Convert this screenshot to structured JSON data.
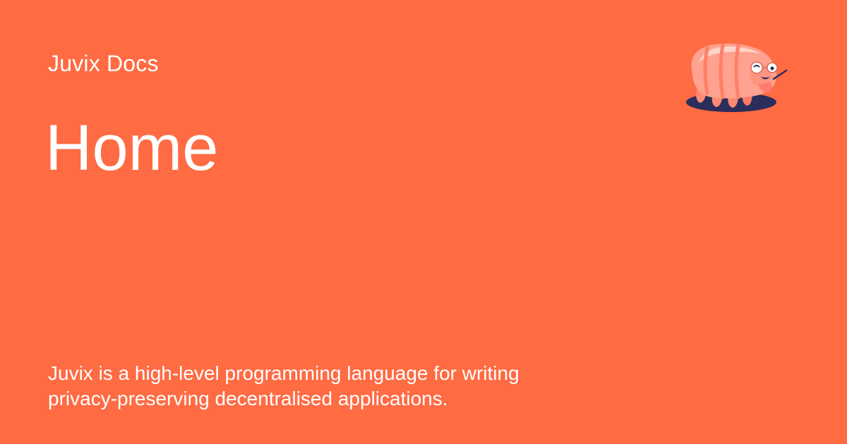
{
  "site": {
    "name": "Juvix Docs"
  },
  "page": {
    "title": "Home",
    "description": "Juvix is a high-level programming language for writing privacy-preserving decentralised applications."
  },
  "logo": {
    "icon": "tardigrade-mascot-icon"
  },
  "colors": {
    "background": "#ff6b43",
    "text": "#ffffff"
  }
}
